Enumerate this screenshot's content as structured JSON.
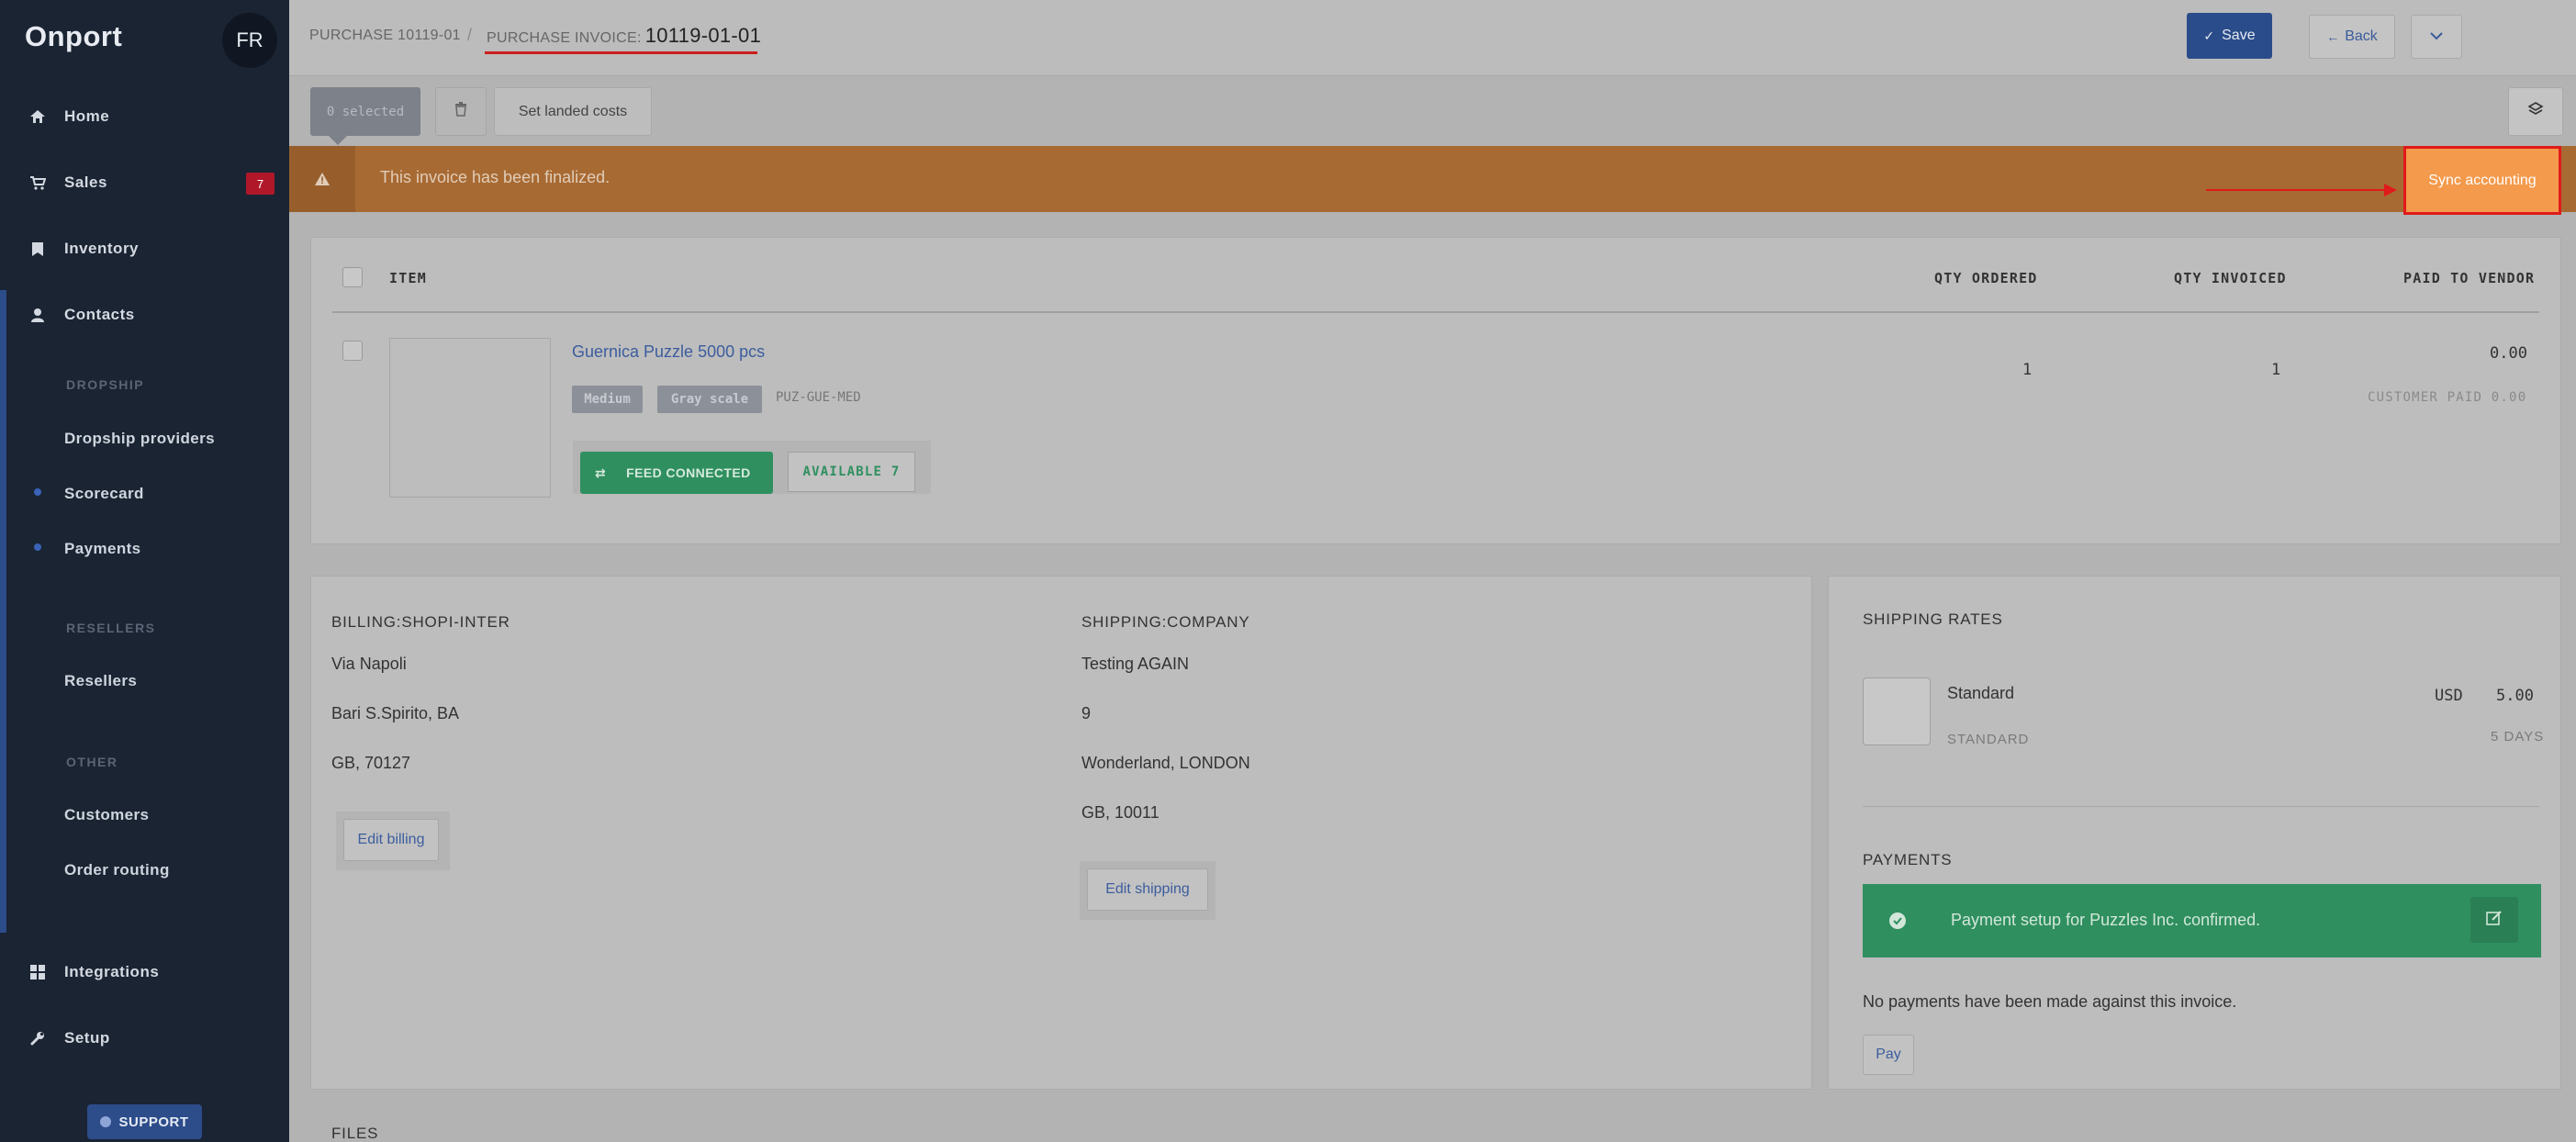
{
  "sidebar": {
    "logo": "Onport",
    "avatar": "FR",
    "nav": {
      "home": "Home",
      "sales": "Sales",
      "sales_badge": "7",
      "inventory": "Inventory",
      "contacts": "Contacts",
      "integrations": "Integrations",
      "setup": "Setup"
    },
    "sections": {
      "dropship": "DROPSHIP",
      "resellers": "RESELLERS",
      "other": "OTHER"
    },
    "sub": {
      "dropship_providers": "Dropship providers",
      "scorecard": "Scorecard",
      "payments": "Payments",
      "resellers": "Resellers",
      "customers": "Customers",
      "order_routing": "Order routing"
    },
    "support": "SUPPORT"
  },
  "header": {
    "crumb_parent": "PURCHASE 10119-01",
    "crumb_sep": "/",
    "crumb_label": "PURCHASE INVOICE:",
    "crumb_id": "10119-01-01",
    "back": "Back",
    "save": "Save"
  },
  "toolbar": {
    "selected": "0 selected",
    "landed_costs": "Set landed costs"
  },
  "banner": {
    "text": "This invoice has been finalized.",
    "sync": "Sync accounting"
  },
  "items": {
    "headers": {
      "item": "ITEM",
      "qty_ordered": "QTY ORDERED",
      "qty_invoiced": "QTY INVOICED",
      "paid_to_vendor": "PAID TO VENDOR"
    },
    "rows": [
      {
        "name": "Guernica Puzzle 5000 pcs",
        "tags": [
          "Medium",
          "Gray scale"
        ],
        "sku": "PUZ-GUE-MED",
        "feed": "FEED CONNECTED",
        "available": "AVAILABLE 7",
        "qty_ordered": "1",
        "qty_invoiced": "1",
        "paid": "0.00",
        "customer_paid": "CUSTOMER PAID 0.00"
      }
    ]
  },
  "billing": {
    "label": "BILLING:SHOPI-INTER",
    "lines": [
      "Via Napoli",
      "Bari S.Spirito, BA",
      "GB, 70127"
    ],
    "edit": "Edit billing"
  },
  "shipping": {
    "label": "SHIPPING:COMPANY",
    "lines": [
      "Testing AGAIN",
      "9",
      "Wonderland, LONDON",
      "GB, 10011"
    ],
    "edit": "Edit shipping"
  },
  "rates": {
    "title": "SHIPPING RATES",
    "name": "Standard",
    "code": "STANDARD",
    "currency": "USD",
    "amount": "5.00",
    "days": "5 DAYS"
  },
  "payments": {
    "title": "PAYMENTS",
    "confirmed": "Payment setup for Puzzles Inc. confirmed.",
    "none": "No payments have been made against this invoice.",
    "pay": "Pay"
  },
  "files": {
    "title": "FILES"
  }
}
